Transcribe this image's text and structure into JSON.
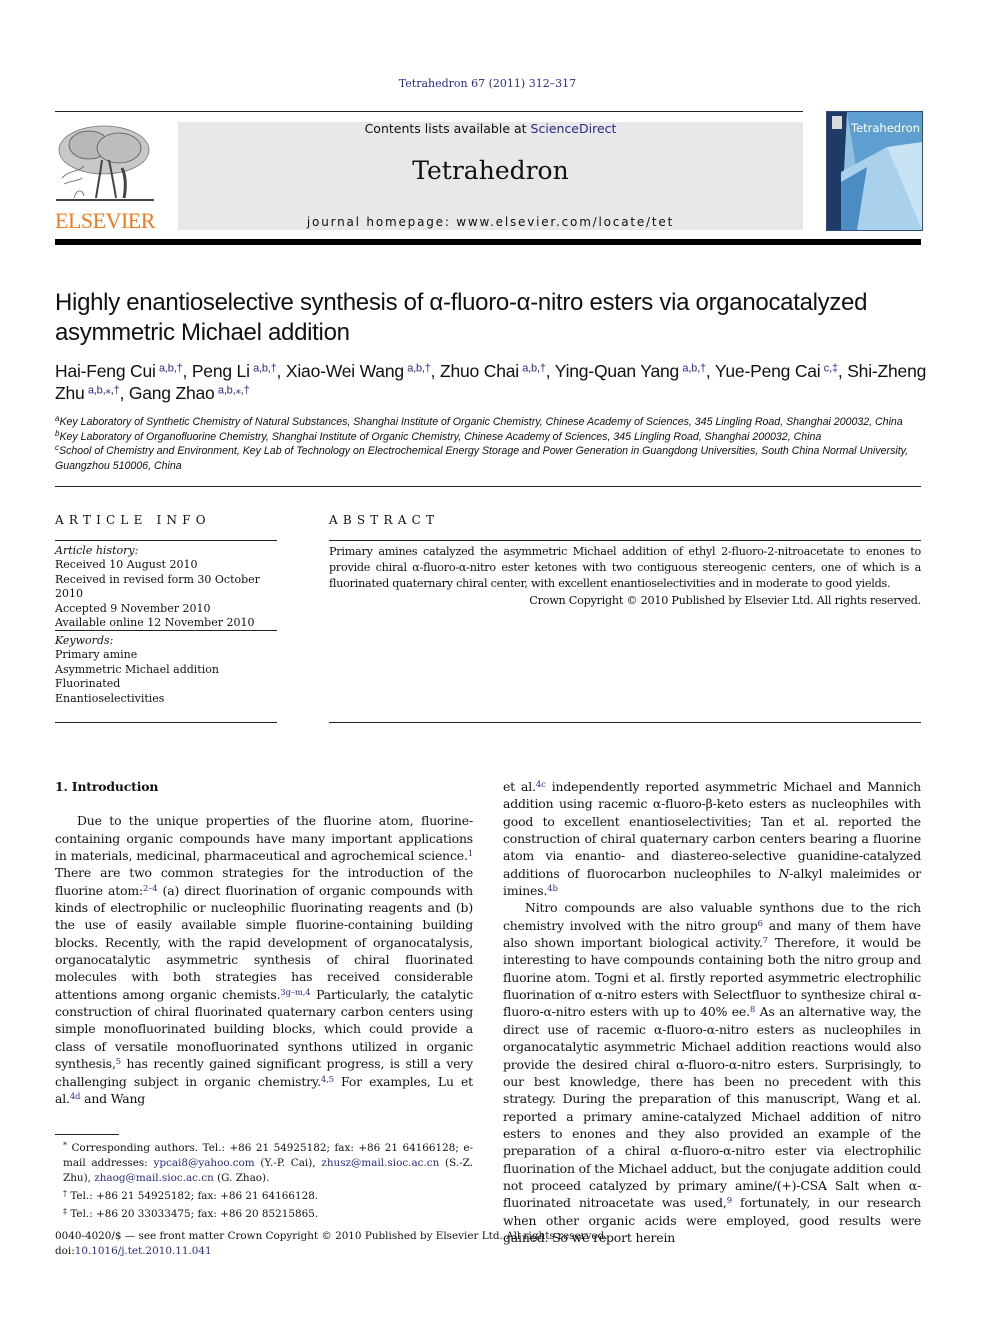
{
  "header": {
    "journal_ref": "Tetrahedron 67 (2011) 312–317",
    "publisher_wordmark": "ELSEVIER",
    "contents_prefix": "Contents lists available at ",
    "contents_link": "ScienceDirect",
    "journal_title": "Tetrahedron",
    "homepage_prefix": "journal homepage: ",
    "homepage_url": "www.elsevier.com/locate/tet",
    "cover_title": "Tetrahedron",
    "colors": {
      "elsevier_orange": "#f07a1a",
      "link_blue": "#2a2a8c",
      "banner_gray": "#e8e8e8"
    }
  },
  "article": {
    "title": "Highly enantioselective synthesis of α-fluoro-α-nitro esters via organocatalyzed asymmetric Michael addition",
    "authors": [
      {
        "name": "Hai-Feng Cui",
        "marks": "a,b,†"
      },
      {
        "name": "Peng Li",
        "marks": "a,b,†"
      },
      {
        "name": "Xiao-Wei Wang",
        "marks": "a,b,†"
      },
      {
        "name": "Zhuo Chai",
        "marks": "a,b,†"
      },
      {
        "name": "Ying-Quan Yang",
        "marks": "a,b,†"
      },
      {
        "name": "Yue-Peng Cai",
        "marks": "c,‡"
      },
      {
        "name": "Shi-Zheng Zhu",
        "marks": "a,b,⁎,†"
      },
      {
        "name": "Gang Zhao",
        "marks": "a,b,⁎,†"
      }
    ],
    "affiliations": [
      {
        "mark": "a",
        "text": "Key Laboratory of Synthetic Chemistry of Natural Substances, Shanghai Institute of Organic Chemistry, Chinese Academy of Sciences, 345 Lingling Road, Shanghai 200032, China"
      },
      {
        "mark": "b",
        "text": "Key Laboratory of Organofluorine Chemistry, Shanghai Institute of Organic Chemistry, Chinese Academy of Sciences, 345 Lingling Road, Shanghai 200032, China"
      },
      {
        "mark": "c",
        "text": "School of Chemistry and Environment, Key Lab of Technology on Electrochemical Energy Storage and Power Generation in Guangdong Universities, South China Normal University, Guangzhou 510006, China"
      }
    ]
  },
  "article_info": {
    "heading": "ARTICLE INFO",
    "history_label": "Article history:",
    "history": [
      "Received 10 August 2010",
      "Received in revised form 30 October 2010",
      "Accepted 9 November 2010",
      "Available online 12 November 2010"
    ],
    "keywords_label": "Keywords:",
    "keywords": [
      "Primary amine",
      "Asymmetric Michael addition",
      "Fluorinated",
      "Enantioselectivities"
    ]
  },
  "abstract": {
    "heading": "ABSTRACT",
    "text": "Primary amines catalyzed the asymmetric Michael addition of ethyl 2-fluoro-2-nitroacetate to enones to provide chiral α-fluoro-α-nitro ester ketones with two contiguous stereogenic centers, one of which is a fluorinated quaternary chiral center, with excellent enantioselectivities and in moderate to good yields.",
    "copyright": "Crown Copyright © 2010 Published by Elsevier Ltd. All rights reserved."
  },
  "body": {
    "section_heading": "1.  Introduction",
    "left_para": [
      {
        "t": "Due to the unique properties of the fluorine atom, fluorine-containing organic compounds have many important applications in materials, medicinal, pharmaceutical and agrochemical science."
      },
      {
        "ref": "1"
      },
      {
        "t": " There are two common strategies for the introduction of the fluorine atom:"
      },
      {
        "ref": "2–4"
      },
      {
        "t": " (a) direct fluorination of organic compounds with kinds of electrophilic or nucleophilic fluorinating reagents and (b) the use of easily available simple fluorine-containing building blocks. Recently, with the rapid development of organocatalysis, organocatalytic asymmetric synthesis of chiral fluorinated molecules with both strategies has received considerable attentions among organic chemists."
      },
      {
        "ref": "3g–m,4"
      },
      {
        "t": " Particularly, the catalytic construction of chiral fluorinated quaternary carbon centers using simple monofluorinated building blocks, which could provide a class of versatile monofluorinated synthons utilized in organic synthesis,"
      },
      {
        "ref": "5"
      },
      {
        "t": " has recently gained significant progress, is still a very challenging subject in organic chemistry."
      },
      {
        "ref": "4,5"
      },
      {
        "t": " For examples, Lu et al."
      },
      {
        "ref": "4d"
      },
      {
        "t": " and Wang"
      }
    ],
    "right_para1": [
      {
        "t": "et al."
      },
      {
        "ref": "4c"
      },
      {
        "t": " independently reported asymmetric Michael and Mannich addition using racemic α-fluoro-β-keto esters as nucleophiles with good to excellent enantioselectivities; Tan et al. reported the construction of chiral quaternary carbon centers bearing a fluorine atom via enantio- and diastereo-selective guanidine-catalyzed additions of fluorocarbon nucleophiles to "
      },
      {
        "i": "N"
      },
      {
        "t": "-alkyl maleimides or imines."
      },
      {
        "ref": "4b"
      }
    ],
    "right_para2": [
      {
        "t": "Nitro compounds are also valuable synthons due to the rich chemistry involved with the nitro group"
      },
      {
        "ref": "6"
      },
      {
        "t": " and many of them have also shown important biological activity."
      },
      {
        "ref": "7"
      },
      {
        "t": " Therefore, it would be interesting to have compounds containing both the nitro group and fluorine atom. Togni et al. firstly reported asymmetric electrophilic fluorination of α-nitro esters with Selectfluor to synthesize chiral α-fluoro-α-nitro esters with up to 40% ee."
      },
      {
        "ref": "8"
      },
      {
        "t": " As an alternative way, the direct use of racemic α-fluoro-α-nitro esters as nucleophiles in organocatalytic asymmetric Michael addition reactions would also provide the desired chiral α-fluoro-α-nitro esters. Surprisingly, to our best knowledge, there has been no precedent with this strategy. During the preparation of this manuscript, Wang et al. reported a primary amine-catalyzed Michael addition of nitro esters to enones and they also provided an example of the preparation of a chiral α-fluoro-α-nitro ester via electrophilic fluorination of the Michael adduct, but the conjugate addition could not proceed catalyzed by primary amine/(+)-CSA Salt when α-fluorinated nitroacetate was used,"
      },
      {
        "ref": "9"
      },
      {
        "t": " fortunately, in our research when other organic acids were employed, good results were gained. So we report herein"
      }
    ]
  },
  "footnotes": {
    "corresponding_mark": "*",
    "corresponding_text": " Corresponding authors. Tel.: +86 21 54925182; fax: +86 21 64166128; e-mail addresses: ",
    "emails": [
      {
        "addr": "ypcai8@yahoo.com",
        "who": " (Y.-P. Cai), "
      },
      {
        "addr": "zhusz@mail.sioc.ac.cn",
        "who": " (S.-Z. Zhu), "
      },
      {
        "addr": "zhaog@mail.sioc.ac.cn",
        "who": " (G. Zhao)."
      }
    ],
    "dagger_mark": "†",
    "dagger_text": "Tel.: +86 21 54925182; fax: +86 21 64166128.",
    "ddagger_mark": "‡",
    "ddagger_text": "Tel.: +86 20 33033475; fax: +86 20 85215865."
  },
  "front_matter": {
    "issn_line": "0040-4020/$ — see front matter Crown Copyright © 2010 Published by Elsevier Ltd. All rights reserved.",
    "doi_prefix": "doi:",
    "doi": "10.1016/j.tet.2010.11.041"
  }
}
